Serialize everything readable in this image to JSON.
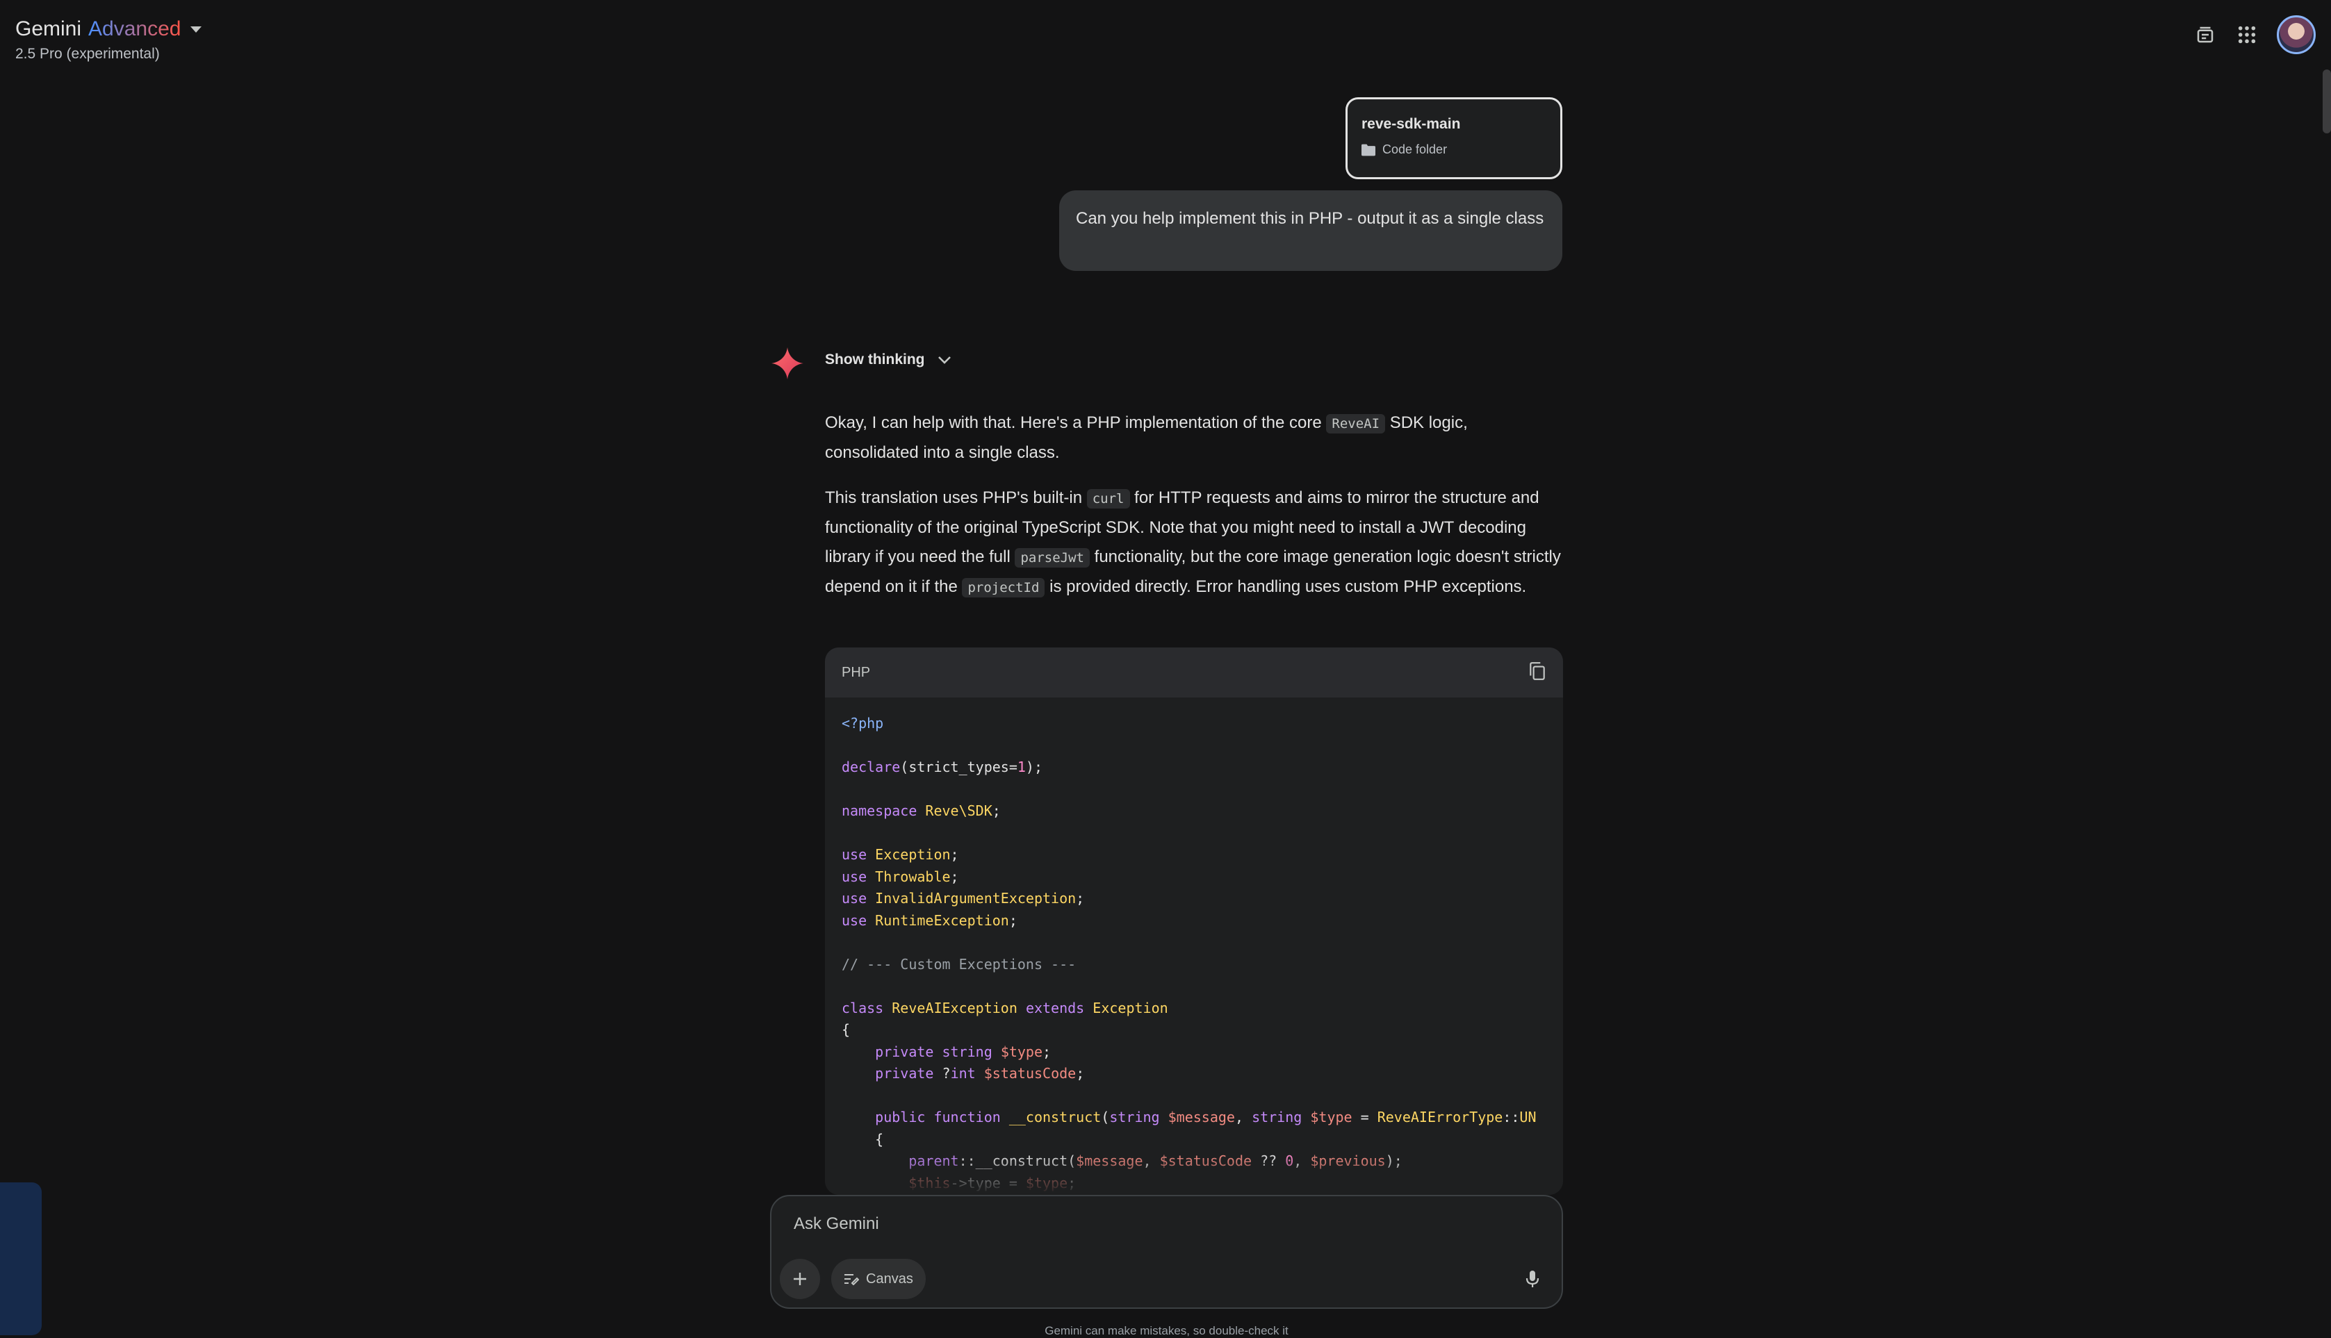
{
  "header": {
    "brand": "Gemini",
    "brand_tier": "Advanced",
    "model": "2.5 Pro (experimental)"
  },
  "topbar_icons": [
    "temporary-chat-icon",
    "apps-grid-icon",
    "account-avatar"
  ],
  "attachment": {
    "name": "reve-sdk-main",
    "type": "Code folder"
  },
  "user_message": "Can you help implement this in PHP - output it as a single class",
  "thinking": {
    "label": "Show thinking"
  },
  "response": {
    "p1_a": "Okay, I can help with that. Here's a PHP implementation of the core ",
    "p1_code": "ReveAI",
    "p1_b": " SDK logic, consolidated into a single class.",
    "p2_a": "This translation uses PHP's built-in ",
    "p2_code1": "curl",
    "p2_b": " for HTTP requests and aims to mirror the structure and functionality of the original TypeScript SDK. Note that you might need to install a JWT decoding library if you need the full ",
    "p2_code2": "parseJwt",
    "p2_c": " functionality, but the core image generation logic doesn't strictly depend on it if the ",
    "p2_code3": "projectId",
    "p2_d": " is provided directly. Error handling uses custom PHP exceptions."
  },
  "code_block": {
    "language": "PHP",
    "lines": [
      "<?php",
      "",
      "declare(strict_types=1);",
      "",
      "namespace Reve\\SDK;",
      "",
      "use Exception;",
      "use Throwable;",
      "use InvalidArgumentException;",
      "use RuntimeException;",
      "",
      "// --- Custom Exceptions ---",
      "",
      "class ReveAIException extends Exception",
      "{",
      "    private string $type;",
      "    private ?int $statusCode;",
      "",
      "    public function __construct(string $message, string $type = ReveAIErrorType::UN",
      "    {",
      "        parent::__construct($message, $statusCode ?? 0, $previous);",
      "        $this->type = $type;"
    ]
  },
  "composer": {
    "placeholder": "Ask Gemini",
    "canvas_label": "Canvas"
  },
  "disclaimer": "Gemini can make mistakes, so double-check it"
}
